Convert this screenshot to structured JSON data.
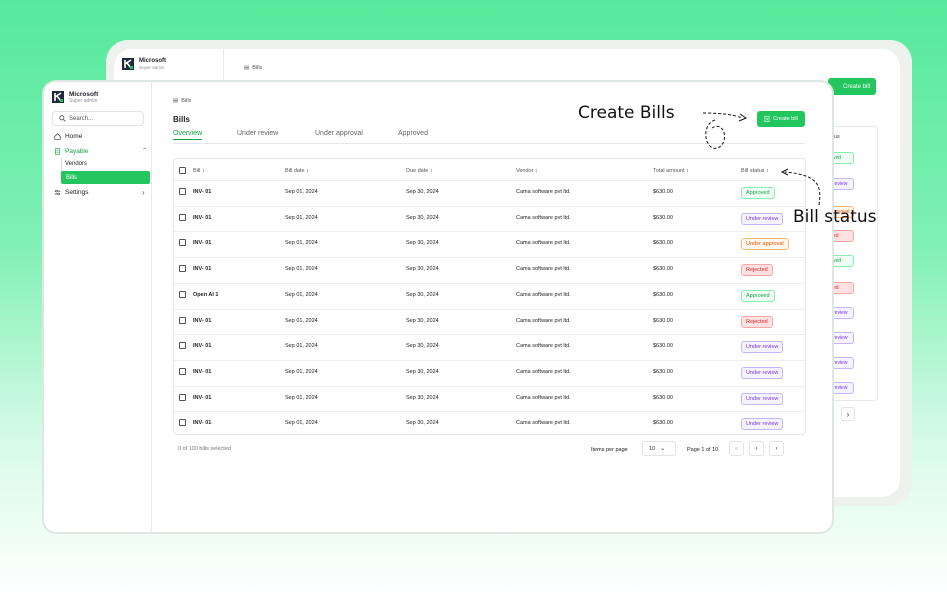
{
  "background_window": {
    "brand": "Microsoft",
    "role": "Super admin",
    "breadcrumb": "Bills",
    "create_button": "Create bill",
    "column_header": "us",
    "badges": [
      "ved",
      "review",
      "pproval",
      "ed",
      "ved",
      "ed",
      "review",
      "review",
      "review",
      "review"
    ],
    "next": "›"
  },
  "sidebar": {
    "brand": "Microsoft",
    "role": "Super admin",
    "search_placeholder": "Search...",
    "items": {
      "home": "Home",
      "payable": "Payable",
      "vendors": "Vendors",
      "bills": "Bills",
      "settings": "Settings"
    }
  },
  "header": {
    "breadcrumb": "Bills",
    "title": "Bills",
    "create_button": "Create bill"
  },
  "tabs": [
    "Overview",
    "Under review",
    "Under approval",
    "Approved"
  ],
  "table": {
    "columns": [
      "Bill ↕",
      "Bill date ↕",
      "Due date ↕",
      "Vendor ↕",
      "Total amount ↕",
      "Bill status ↕"
    ],
    "rows": [
      {
        "bill": "INV- 01",
        "bill_date": "Sep 01, 2024",
        "due_date": "Sep 30, 2024",
        "vendor": "Cama software pvt ltd.",
        "amount": "$630.00",
        "status": "Approved"
      },
      {
        "bill": "INV- 01",
        "bill_date": "Sep 01, 2024",
        "due_date": "Sep 30, 2024",
        "vendor": "Cama software pvt ltd.",
        "amount": "$630.00",
        "status": "Under review"
      },
      {
        "bill": "INV- 01",
        "bill_date": "Sep 01, 2024",
        "due_date": "Sep 30, 2024",
        "vendor": "Cama software pvt ltd.",
        "amount": "$630.00",
        "status": "Under approval"
      },
      {
        "bill": "INV- 01",
        "bill_date": "Sep 01, 2024",
        "due_date": "Sep 30, 2024",
        "vendor": "Cama software pvt ltd.",
        "amount": "$630.00",
        "status": "Rejected"
      },
      {
        "bill": "Open AI 1",
        "bill_date": "Sep 01, 2024",
        "due_date": "Sep 30, 2024",
        "vendor": "Cama software pvt ltd.",
        "amount": "$630.00",
        "status": "Approved"
      },
      {
        "bill": "INV- 01",
        "bill_date": "Sep 01, 2024",
        "due_date": "Sep 30, 2024",
        "vendor": "Cama software pvt ltd.",
        "amount": "$630.00",
        "status": "Rejected"
      },
      {
        "bill": "INV- 01",
        "bill_date": "Sep 01, 2024",
        "due_date": "Sep 30, 2024",
        "vendor": "Cama software pvt ltd.",
        "amount": "$630.00",
        "status": "Under review"
      },
      {
        "bill": "INV- 01",
        "bill_date": "Sep 01, 2024",
        "due_date": "Sep 30, 2024",
        "vendor": "Cama software pvt ltd.",
        "amount": "$630.00",
        "status": "Under review"
      },
      {
        "bill": "INV- 01",
        "bill_date": "Sep 01, 2024",
        "due_date": "Sep 30, 2024",
        "vendor": "Cama software pvt ltd.",
        "amount": "$630.00",
        "status": "Under review"
      },
      {
        "bill": "INV- 01",
        "bill_date": "Sep 01, 2024",
        "due_date": "Sep 30, 2024",
        "vendor": "Cama software pvt ltd.",
        "amount": "$630.00",
        "status": "Under review"
      }
    ]
  },
  "footer": {
    "selected": "0 of 100 bills selected",
    "items_per_page_label": "Items per page",
    "items_per_page_value": "10",
    "page_info": "Page 1 of 10",
    "first": "«",
    "prev": "‹",
    "next": "›"
  },
  "annotations": {
    "create_bills": "Create Bills",
    "bill_status": "Bill status"
  },
  "status_colors": {
    "Approved": {
      "text": "#16a34a",
      "border": "#86efac",
      "bg": "#f0fdf4"
    },
    "Under review": {
      "text": "#7c3aed",
      "border": "#c4b5fd",
      "bg": "#f5f3ff"
    },
    "Under approval": {
      "text": "#ea580c",
      "border": "#fdba74",
      "bg": "#fff7ed"
    },
    "Rejected": {
      "text": "#dc2626",
      "border": "#fca5a5",
      "bg": "#fee2e2"
    }
  },
  "icons": [
    "search-icon",
    "home-icon",
    "file-icon",
    "settings-icon",
    "chevron-up-icon",
    "chevron-right-icon",
    "plus-file-icon",
    "chevron-down-icon"
  ]
}
